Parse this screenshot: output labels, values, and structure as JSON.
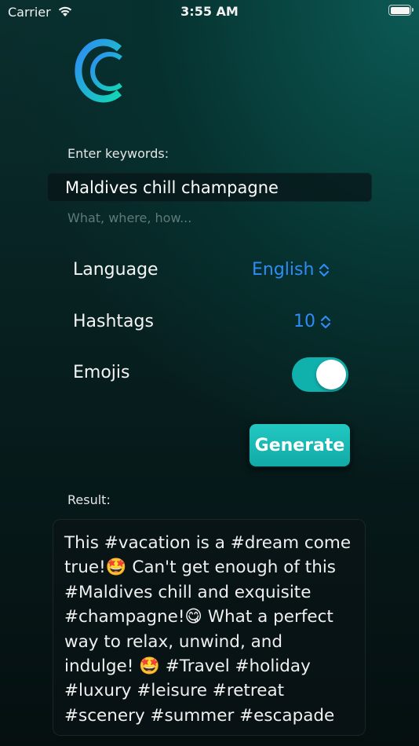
{
  "status_bar": {
    "carrier": "Carrier",
    "time": "3:55 AM"
  },
  "logo": {
    "letter": "C",
    "gradient": [
      "#2f8bf5",
      "#13d6b4"
    ]
  },
  "keywords": {
    "label": "Enter keywords:",
    "value": "Maldives chill champagne",
    "hint": "What, where, how..."
  },
  "settings": {
    "language": {
      "label": "Language",
      "value": "English"
    },
    "hashtags": {
      "label": "Hashtags",
      "value": "10"
    },
    "emojis": {
      "label": "Emojis",
      "enabled": true
    }
  },
  "generate": {
    "label": "Generate"
  },
  "result": {
    "label": "Result:",
    "text": "This #vacation is a #dream come true!🤩 Can't get enough of this #Maldives chill and exquisite #champagne!😋 What a perfect way to relax, unwind, and indulge! 🤩 #Travel #holiday #luxury #leisure #retreat #scenery #summer #escapade"
  },
  "colors": {
    "accent": "#2f8bf5",
    "button": "#17b8b3",
    "toggle_on": "#10b0ad"
  }
}
